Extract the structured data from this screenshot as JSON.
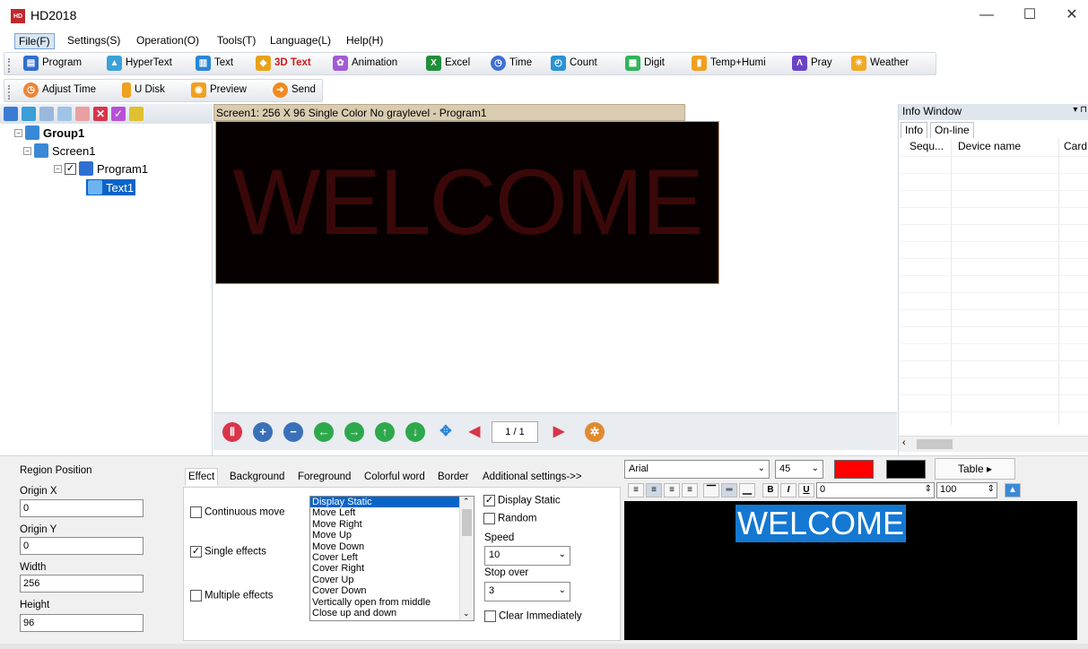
{
  "window": {
    "title": "HD2018",
    "minimize": "—",
    "maximize": "☐",
    "close": "✕"
  },
  "menu": [
    "File(F)",
    "Settings(S)",
    "Operation(O)",
    "Tools(T)",
    "Language(L)",
    "Help(H)"
  ],
  "toolbar1": [
    {
      "label": "Program",
      "icon": "program-icon",
      "color": "#2f6fd1"
    },
    {
      "label": "HyperText",
      "icon": "image-icon",
      "color": "#3aa2d8"
    },
    {
      "label": "Text",
      "icon": "book-icon",
      "color": "#2a86d6"
    },
    {
      "label": "3D Text",
      "icon": "cube-icon",
      "color": "#e8a21a"
    },
    {
      "label": "Animation",
      "icon": "flower-icon",
      "color": "#a25bd6"
    },
    {
      "label": "Excel",
      "icon": "excel-icon",
      "color": "#1f8f3a"
    },
    {
      "label": "Time",
      "icon": "clock-icon",
      "color": "#3d6fd6"
    },
    {
      "label": "Count",
      "icon": "counter-icon",
      "color": "#2a93d5"
    },
    {
      "label": "Digit",
      "icon": "grid-icon",
      "color": "#31b45a"
    },
    {
      "label": "Temp+Humi",
      "icon": "thermometer-icon",
      "color": "#f0a020"
    },
    {
      "label": "Pray",
      "icon": "pray-icon",
      "color": "#6a42c8"
    },
    {
      "label": "Weather",
      "icon": "weather-icon",
      "color": "#f2a922"
    }
  ],
  "toolbar2": [
    {
      "label": "Adjust Time",
      "icon": "adjust-clock-icon",
      "color": "#e9873a"
    },
    {
      "label": "U Disk",
      "icon": "usb-icon",
      "color": "#f0a020"
    },
    {
      "label": "Preview",
      "icon": "preview-icon",
      "color": "#f0a020"
    },
    {
      "label": "Send",
      "icon": "send-icon",
      "color": "#f08a20"
    }
  ],
  "tree": {
    "group": "Group1",
    "screen": "Screen1",
    "program": "Program1",
    "text": "Text1"
  },
  "screen": {
    "header": "Screen1: 256 X 96  Single Color No graylevel - Program1",
    "led_text": "WELCOME",
    "page": "1 / 1"
  },
  "info": {
    "title": "Info Window",
    "pin": "▾ ⊓",
    "tabs": [
      "Info",
      "On-line"
    ],
    "columns": [
      "Sequ...",
      "Device name",
      "Card"
    ]
  },
  "region": {
    "title": "Region Position",
    "origin_x_label": "Origin X",
    "origin_x": "0",
    "origin_y_label": "Origin Y",
    "origin_y": "0",
    "width_label": "Width",
    "width": "256",
    "height_label": "Height",
    "height": "96"
  },
  "effect_tabs": [
    "Effect",
    "Background",
    "Foreground",
    "Colorful word",
    "Border",
    "Additional settings->>"
  ],
  "effects": {
    "continuous": "Continuous move",
    "single": "Single effects",
    "multiple": "Multiple effects",
    "list": [
      "Display Static",
      "Move Left",
      "Move Right",
      "Move Up",
      "Move Down",
      "Cover Left",
      "Cover Right",
      "Cover Up",
      "Cover Down",
      "Vertically open from middle",
      "Close up and down"
    ],
    "display_static": "Display Static",
    "random": "Random",
    "speed_label": "Speed",
    "speed": "10",
    "stop_label": "Stop over",
    "stop": "3",
    "clear": "Clear Immediately"
  },
  "editor": {
    "font": "Arial",
    "size": "45",
    "table": "Table",
    "indent": "0",
    "scale": "100",
    "text": "WELCOME",
    "text_color": "#ff0000",
    "bg_color": "#000000"
  }
}
